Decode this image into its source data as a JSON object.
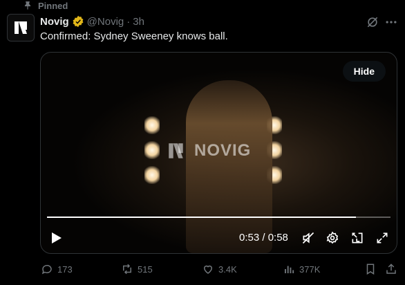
{
  "pinned_label": "Pinned",
  "post": {
    "display_name": "Novig",
    "handle": "@Novig",
    "separator": "·",
    "time": "3h",
    "text": "Confirmed: Sydney Sweeney knows ball."
  },
  "video": {
    "watermark_text": "NOVIG",
    "hide_label": "Hide",
    "current_time": "0:53",
    "duration": "0:58",
    "time_display": "0:53 / 0:58",
    "progress_fraction": 0.9
  },
  "actions": {
    "replies": "173",
    "reposts": "515",
    "likes": "3.4K",
    "views": "377K"
  },
  "colors": {
    "background": "#000000",
    "text_primary": "#e7e9ea",
    "text_secondary": "#71767b",
    "verified_gold": "#e2b719",
    "border": "#2f3336"
  },
  "icons": [
    "pin-icon",
    "verified-icon",
    "grok-icon",
    "more-icon",
    "play-icon",
    "mute-icon",
    "settings-icon",
    "pip-icon",
    "fullscreen-icon",
    "reply-icon",
    "repost-icon",
    "like-icon",
    "views-icon",
    "bookmark-icon",
    "share-icon"
  ]
}
